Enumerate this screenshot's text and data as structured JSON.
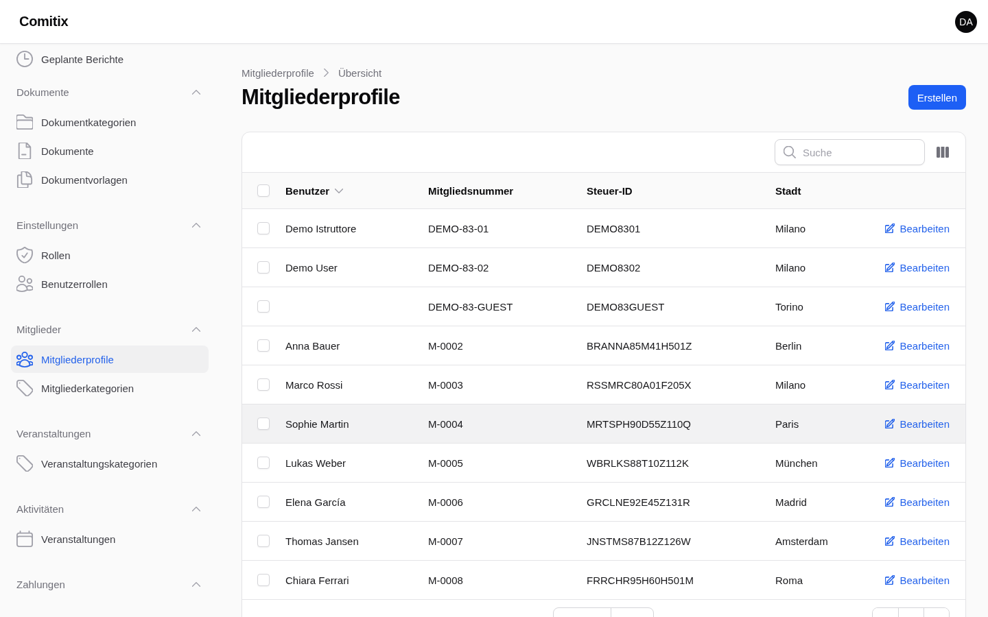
{
  "header": {
    "logo": "Comitix",
    "avatar": "DA"
  },
  "sidebar": {
    "groups": [
      {
        "items": [
          {
            "label": "Geplante Berichte",
            "kind": "clock",
            "selected": false
          }
        ]
      },
      {
        "title": "Dokumente",
        "expanded": true,
        "items": [
          {
            "label": "Dokumentkategorien",
            "kind": "folder",
            "selected": false
          },
          {
            "label": "Dokumente",
            "kind": "document",
            "selected": false
          },
          {
            "label": "Dokumentvorlagen",
            "kind": "documents",
            "selected": false
          }
        ]
      },
      {
        "title": "Einstellungen",
        "expanded": true,
        "items": [
          {
            "label": "Rollen",
            "kind": "shield",
            "selected": false
          },
          {
            "label": "Benutzerrollen",
            "kind": "users",
            "selected": false
          }
        ]
      },
      {
        "title": "Mitglieder",
        "expanded": true,
        "items": [
          {
            "label": "Mitgliederprofile",
            "kind": "user-group",
            "selected": true
          },
          {
            "label": "Mitgliederkategorien",
            "kind": "tag",
            "selected": false
          }
        ]
      },
      {
        "title": "Veranstaltungen",
        "expanded": true,
        "items": [
          {
            "label": "Veranstaltungskategorien",
            "kind": "tag",
            "selected": false
          }
        ]
      },
      {
        "title": "Aktivitäten",
        "expanded": true,
        "items": [
          {
            "label": "Veranstaltungen",
            "kind": "calendar",
            "selected": false
          }
        ]
      },
      {
        "title": "Zahlungen",
        "expanded": true
      }
    ]
  },
  "breadcrumb": [
    "Mitgliederprofile",
    "Übersicht"
  ],
  "page_title": "Mitgliederprofile",
  "create_button": "Erstellen",
  "table": {
    "search": {
      "placeholder": "Suche"
    },
    "select_all": {
      "checked": false
    },
    "columns": [
      {
        "label": "Benutzer",
        "sorted": true
      },
      {
        "label": "Mitgliedsnummer",
        "sorted": false
      },
      {
        "label": "Steuer-ID",
        "sorted": false
      },
      {
        "label": "Stadt",
        "sorted": false
      }
    ],
    "rows": [
      {
        "user": "Demo Istruttore",
        "member_number": "DEMO-83-01",
        "tax_id": "DEMO8301",
        "city": "Milano",
        "action": "Bearbeiten",
        "checked": false,
        "hovered": false
      },
      {
        "user": "Demo User",
        "member_number": "DEMO-83-02",
        "tax_id": "DEMO8302",
        "city": "Milano",
        "action": "Bearbeiten",
        "checked": false,
        "hovered": false
      },
      {
        "member_number": "DEMO-83-GUEST",
        "tax_id": "DEMO83GUEST",
        "city": "Torino",
        "action": "Bearbeiten",
        "checked": false,
        "hovered": false
      },
      {
        "user": "Anna Bauer",
        "member_number": "M-0002",
        "tax_id": "BRANNA85M41H501Z",
        "city": "Berlin",
        "action": "Bearbeiten",
        "checked": false,
        "hovered": false
      },
      {
        "user": "Marco Rossi",
        "member_number": "M-0003",
        "tax_id": "RSSMRC80A01F205X",
        "city": "Milano",
        "action": "Bearbeiten",
        "checked": false,
        "hovered": false
      },
      {
        "user": "Sophie Martin",
        "member_number": "M-0004",
        "tax_id": "MRTSPH90D55Z110Q",
        "city": "Paris",
        "action": "Bearbeiten",
        "checked": false,
        "hovered": true
      },
      {
        "user": "Lukas Weber",
        "member_number": "M-0005",
        "tax_id": "WBRLKS88T10Z112K",
        "city": "München",
        "action": "Bearbeiten",
        "checked": false,
        "hovered": false
      },
      {
        "user": "Elena García",
        "member_number": "M-0006",
        "tax_id": "GRCLNE92E45Z131R",
        "city": "Madrid",
        "action": "Bearbeiten",
        "checked": false,
        "hovered": false
      },
      {
        "user": "Thomas Jansen",
        "member_number": "M-0007",
        "tax_id": "JNSTMS87B12Z126W",
        "city": "Amsterdam",
        "action": "Bearbeiten",
        "checked": false,
        "hovered": false
      },
      {
        "user": "Chiara Ferrari",
        "member_number": "M-0008",
        "tax_id": "FRRCHR95H60H501M",
        "city": "Roma",
        "action": "Bearbeiten",
        "checked": false,
        "hovered": false
      }
    ]
  }
}
